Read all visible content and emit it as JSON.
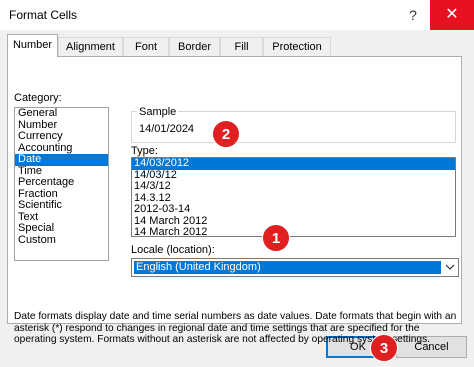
{
  "window": {
    "title": "Format Cells",
    "help_glyph": "?",
    "close_glyph": "✕"
  },
  "tabs": [
    {
      "label": "Number",
      "active": true
    },
    {
      "label": "Alignment",
      "active": false
    },
    {
      "label": "Font",
      "active": false
    },
    {
      "label": "Border",
      "active": false
    },
    {
      "label": "Fill",
      "active": false
    },
    {
      "label": "Protection",
      "active": false
    }
  ],
  "category": {
    "label": "Category:",
    "items": [
      "General",
      "Number",
      "Currency",
      "Accounting",
      "Date",
      "Time",
      "Percentage",
      "Fraction",
      "Scientific",
      "Text",
      "Special",
      "Custom"
    ],
    "selected": "Date"
  },
  "sample": {
    "label": "Sample",
    "value": "14/01/2024"
  },
  "type": {
    "label": "Type:",
    "items": [
      "14/03/2012",
      "14/03/12",
      "14/3/12",
      "14.3.12",
      "2012-03-14",
      "14 March 2012",
      "14 March 2012"
    ],
    "selected": "14/03/2012"
  },
  "locale": {
    "label": "Locale (location):",
    "value": "English (United Kingdom)"
  },
  "description": "Date formats display date and time serial numbers as date values.  Date formats that begin with an asterisk (*) respond to changes in regional date and time settings that are specified for the operating system. Formats without an asterisk are not affected by operating system settings.",
  "buttons": {
    "ok": "OK",
    "cancel": "Cancel"
  },
  "callouts": [
    "1",
    "2",
    "3"
  ],
  "colors": {
    "selection": "#0078d7",
    "close_button": "#e81123",
    "callout": "#e02020"
  }
}
